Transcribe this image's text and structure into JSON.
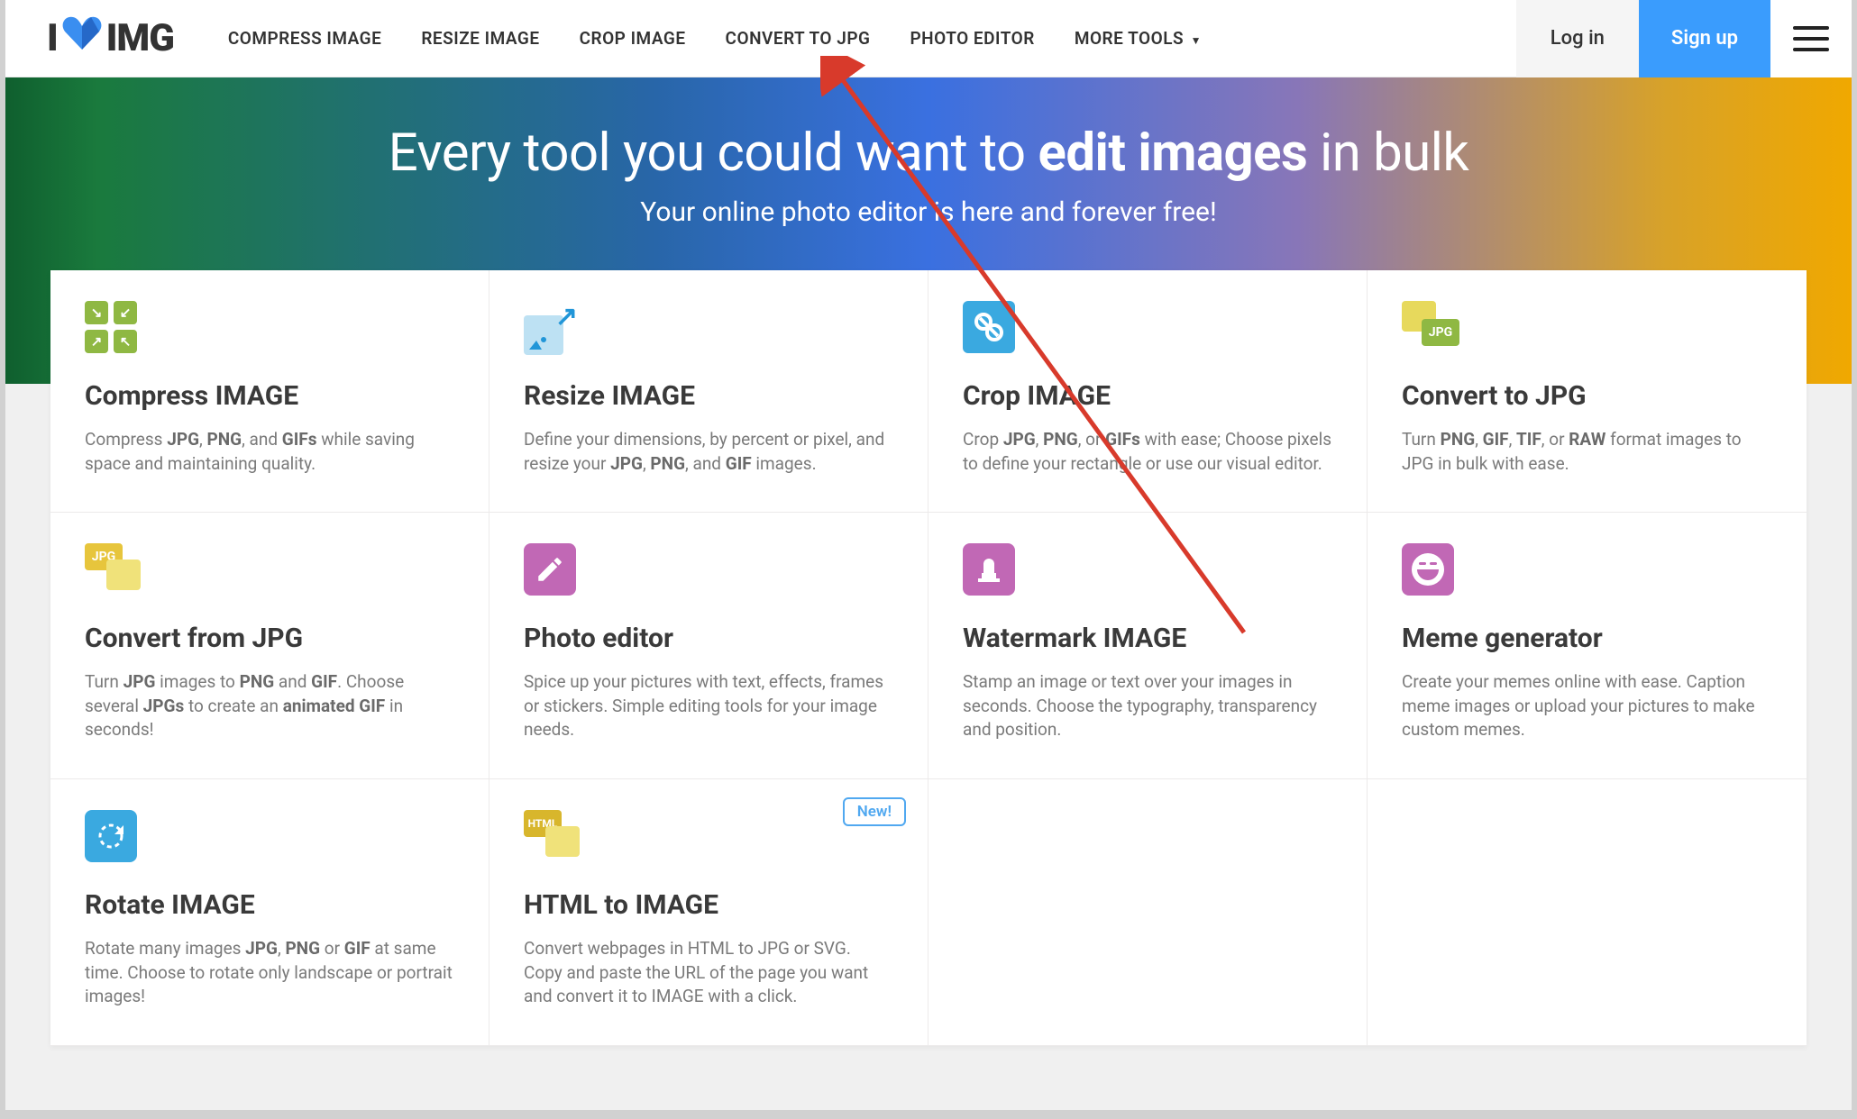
{
  "logo": {
    "pre": "I",
    "post": "IMG"
  },
  "nav": {
    "links": [
      "COMPRESS IMAGE",
      "RESIZE IMAGE",
      "CROP IMAGE",
      "CONVERT TO JPG",
      "PHOTO EDITOR",
      "MORE TOOLS"
    ],
    "login": "Log in",
    "signup": "Sign up"
  },
  "hero": {
    "title_pre": "Every tool you could want to ",
    "title_bold": "edit images",
    "title_post": " in bulk",
    "subtitle": "Your online photo editor is here and forever free!"
  },
  "new_badge": "New!",
  "tools": {
    "compress": {
      "title": "Compress IMAGE",
      "desc_parts": [
        "Compress ",
        "JPG",
        ", ",
        "PNG",
        ", and ",
        "GIFs",
        " while saving space and maintaining quality."
      ]
    },
    "resize": {
      "title": "Resize IMAGE",
      "desc_parts": [
        "Define your dimensions, by percent or pixel, and resize your ",
        "JPG",
        ", ",
        "PNG",
        ", and ",
        "GIF",
        " images."
      ]
    },
    "crop": {
      "title": "Crop IMAGE",
      "desc_parts": [
        "Crop ",
        "JPG",
        ", ",
        "PNG",
        ", or ",
        "GIFs",
        " with ease; Choose pixels to define your rectangle or use our visual editor."
      ]
    },
    "tojpg": {
      "title": "Convert to JPG",
      "desc_parts": [
        "Turn ",
        "PNG",
        ", ",
        "GIF",
        ", ",
        "TIF",
        ", or ",
        "RAW",
        " format images to JPG in bulk with ease."
      ],
      "icon_label": "JPG"
    },
    "fromjpg": {
      "title": "Convert from JPG",
      "desc_parts": [
        "Turn ",
        "JPG",
        " images to ",
        "PNG",
        " and ",
        "GIF",
        ". Choose several ",
        "JPGs",
        " to create an ",
        "animated GIF",
        " in seconds!"
      ],
      "icon_label": "JPG"
    },
    "photo": {
      "title": "Photo editor",
      "desc": "Spice up your pictures with text, effects, frames or stickers. Simple editing tools for your image needs."
    },
    "water": {
      "title": "Watermark IMAGE",
      "desc": "Stamp an image or text over your images in seconds. Choose the typography, transparency and position."
    },
    "meme": {
      "title": "Meme generator",
      "desc": "Create your memes online with ease. Caption meme images or upload your pictures to make custom memes."
    },
    "rotate": {
      "title": "Rotate IMAGE",
      "desc_parts": [
        "Rotate many images ",
        "JPG",
        ", ",
        "PNG",
        " or ",
        "GIF",
        " at same time. Choose to rotate only landscape or portrait images!"
      ]
    },
    "html": {
      "title": "HTML to IMAGE",
      "desc": "Convert webpages in HTML to JPG or SVG. Copy and paste the URL of the page you want and convert it to IMAGE with a click.",
      "icon_label": "HTML"
    }
  }
}
